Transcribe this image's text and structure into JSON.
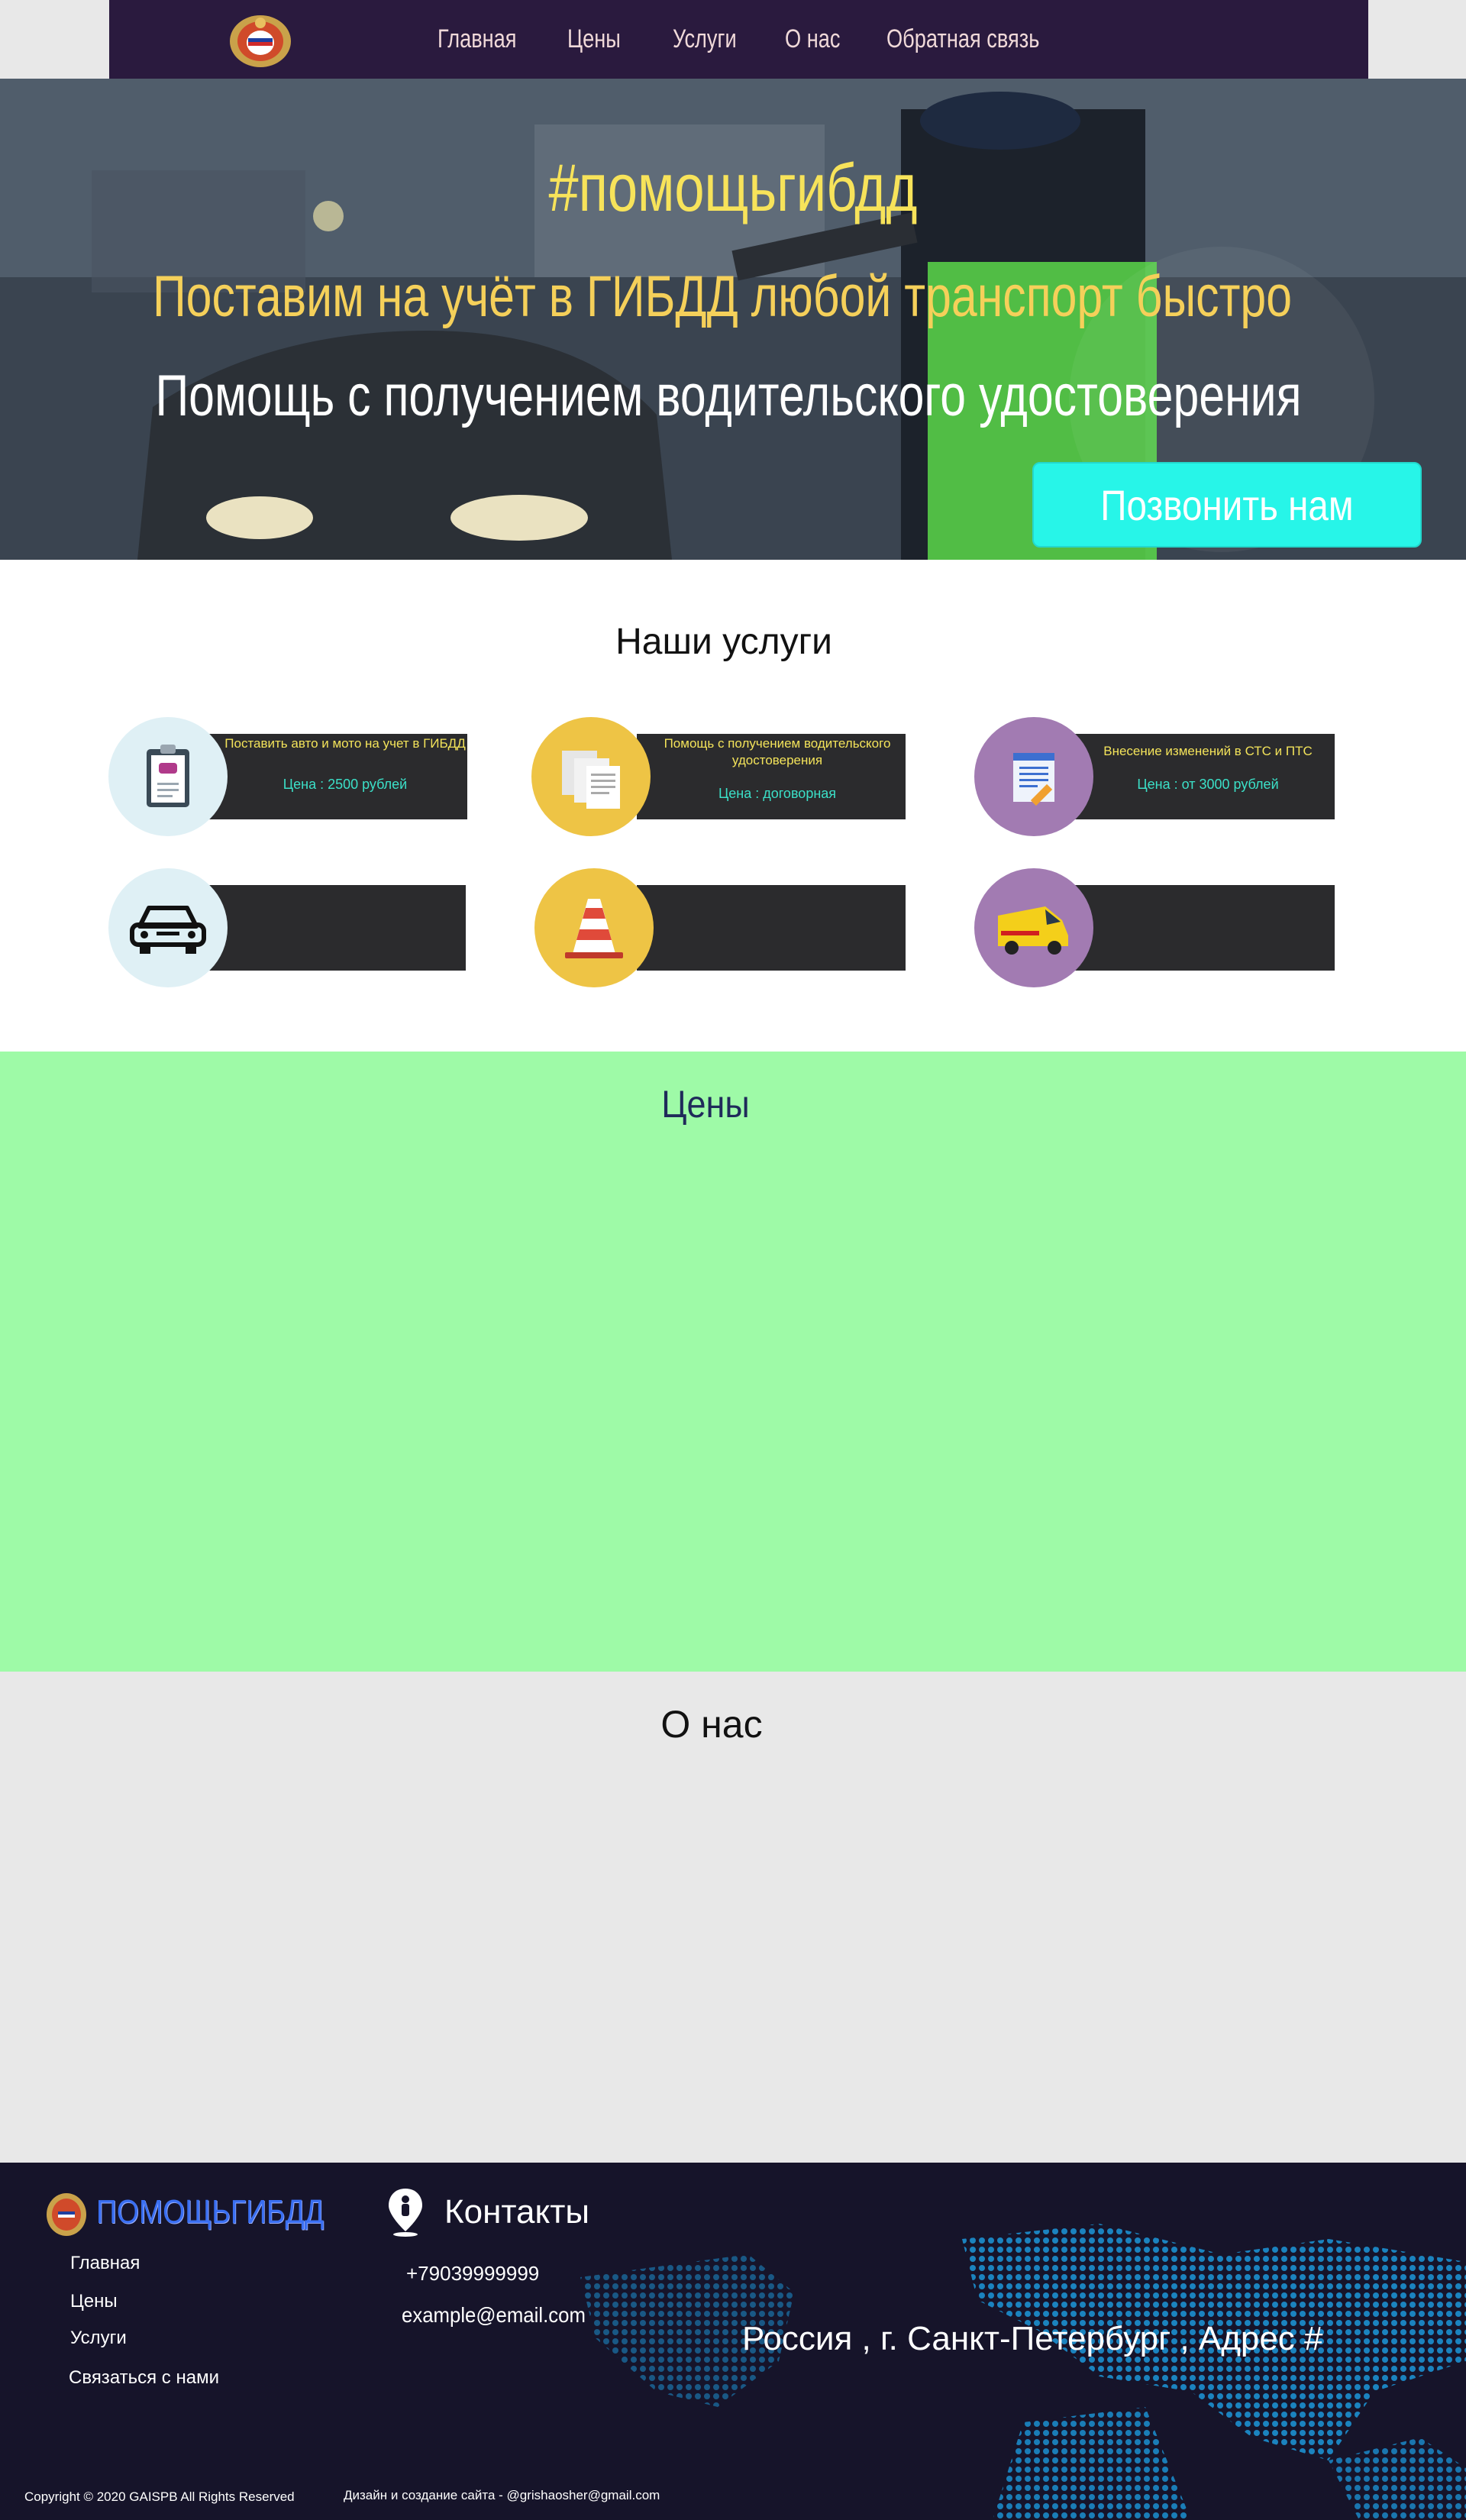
{
  "nav": {
    "items": [
      "Главная",
      "Цены",
      "Услуги",
      "О нас",
      "Обратная связь"
    ]
  },
  "hero": {
    "hashtag": "#помощьгибдд",
    "line1": "Поставим на учёт в ГИБДД любой транспорт быстро",
    "line2": "Помощь с получением водительского удостоверения",
    "call_button": "Позвонить нам"
  },
  "services": {
    "title": "Наши услуги",
    "cards": [
      {
        "icon": "clipboard-car-icon",
        "title": "Поставить авто и мото на учет в ГИБДД",
        "price": "Цена : 2500 рублей",
        "circle": "#dff0f5"
      },
      {
        "icon": "documents-icon",
        "title": "Помощь с получением водительского удостоверения",
        "price": "Цена : договорная",
        "circle": "#eec445"
      },
      {
        "icon": "document-edit-icon",
        "title": "Внесение изменений в СТС и ПТС",
        "price": "Цена : от 3000 рублей",
        "circle": "#a27bb2"
      },
      {
        "icon": "car-icon",
        "title": "",
        "price": "",
        "circle": "#dff0f5"
      },
      {
        "icon": "traffic-cone-icon",
        "title": "",
        "price": "",
        "circle": "#eec445"
      },
      {
        "icon": "van-icon",
        "title": "",
        "price": "",
        "circle": "#a27bb2"
      }
    ]
  },
  "prices": {
    "title": "Цены"
  },
  "about": {
    "title": "О нас"
  },
  "footer": {
    "brand": "ПОМОЩЬГИБДД",
    "links": [
      "Главная",
      "Цены",
      "Услуги",
      "Связаться с нами"
    ],
    "contacts_title": "Контакты",
    "phone": "+79039999999",
    "email": "example@email.com",
    "address": "Россия , г. Санкт-Петербург , Адрес #",
    "copyright": "Copyright © 2020 GAISPB All Rights Reserved",
    "design": "Дизайн и создание сайта - @grishaosher@gmail.com"
  },
  "colors": {
    "nav_bg": "#2a1a3e",
    "accent_cyan": "#27f5e8",
    "hero_yellow": "#f7e35a",
    "prices_bg": "#9efaa7",
    "footer_bg": "#16142a"
  }
}
